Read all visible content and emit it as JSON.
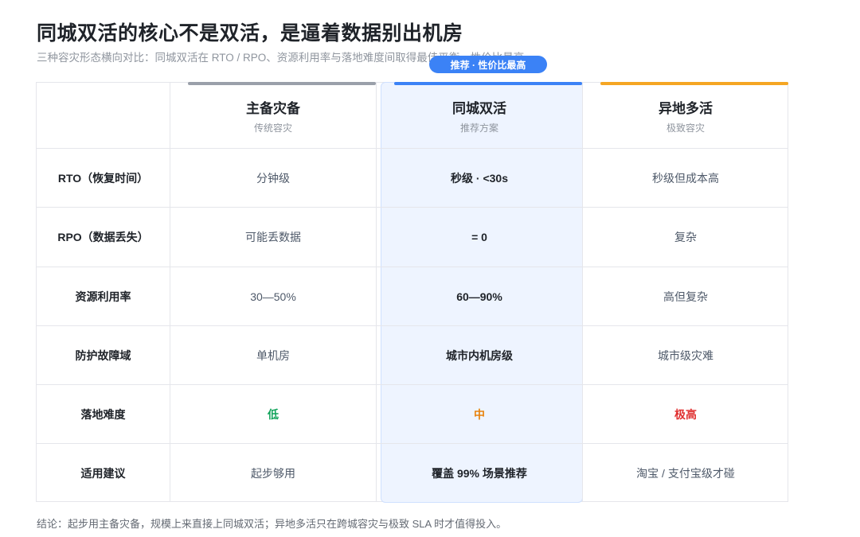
{
  "title": "同城双活的核心不是双活，是逼着数据别出机房",
  "subtitle": "三种容灾形态横向对比：同城双活在 RTO / RPO、资源利用率与落地难度间取得最佳平衡，性价比最高",
  "badge": "推荐 · 性价比最高",
  "columns": [
    {
      "name": "主备灾备",
      "sub": "传统容灾",
      "bar_color": "#9aa0aa"
    },
    {
      "name": "同城双活",
      "sub": "推荐方案",
      "bar_color": "#3b82f6"
    },
    {
      "name": "异地多活",
      "sub": "极致容灾",
      "bar_color": "#f5a623"
    }
  ],
  "rows": [
    {
      "label": "RTO（恢复时间）",
      "values": [
        "分钟级",
        "秒级 · <30s",
        "秒级但成本高"
      ]
    },
    {
      "label": "RPO（数据丢失）",
      "values": [
        "可能丢数据",
        "= 0",
        "复杂"
      ]
    },
    {
      "label": "资源利用率",
      "values": [
        "30—50%",
        "60—90%",
        "高但复杂"
      ]
    },
    {
      "label": "防护故障域",
      "values": [
        "单机房",
        "城市内机房级",
        "城市级灾难"
      ]
    },
    {
      "label": "落地难度",
      "values": [
        "低",
        "中",
        "极高"
      ],
      "colors": [
        "#10a35a",
        "#e8820c",
        "#e03131"
      ]
    },
    {
      "label": "适用建议",
      "values": [
        "起步够用",
        "覆盖 99% 场景推荐",
        "淘宝 / 支付宝级才碰"
      ]
    }
  ],
  "footer": "结论：起步用主备灾备，规模上来直接上同城双活；异地多活只在跨城容灾与极致 SLA 时才值得投入。"
}
